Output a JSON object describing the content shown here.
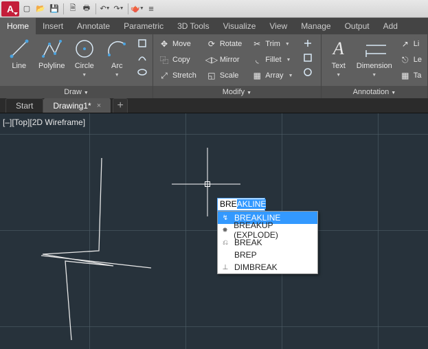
{
  "titlebar": {
    "qat_icons": [
      "new-icon",
      "open-icon",
      "save-icon",
      "saveas-icon",
      "print-icon",
      "undo-icon",
      "redo-icon",
      "plot-icon"
    ]
  },
  "ribbon_tabs": [
    "Home",
    "Insert",
    "Annotate",
    "Parametric",
    "3D Tools",
    "Visualize",
    "View",
    "Manage",
    "Output",
    "Add"
  ],
  "active_ribbon_tab": "Home",
  "panels": {
    "draw": {
      "title": "Draw",
      "items": {
        "line": "Line",
        "polyline": "Polyline",
        "circle": "Circle",
        "arc": "Arc"
      }
    },
    "modify": {
      "title": "Modify",
      "row1": {
        "move": "Move",
        "rotate": "Rotate",
        "trim": "Trim"
      },
      "row2": {
        "copy": "Copy",
        "mirror": "Mirror",
        "fillet": "Fillet"
      },
      "row3": {
        "stretch": "Stretch",
        "scale": "Scale",
        "array": "Array"
      }
    },
    "annotation": {
      "title": "Annotation",
      "text": "Text",
      "dimension": "Dimension",
      "side": {
        "leader": "Le",
        "table": "Ta",
        "line": "Li"
      }
    }
  },
  "file_tabs": {
    "start": "Start",
    "active": "Drawing1*"
  },
  "viewport_label": "[–][Top][2D Wireframe]",
  "command": {
    "typed": "BRE",
    "completion": "AKLINE",
    "suggestions": [
      {
        "label": "BREAKLINE",
        "icon": "breakline-icon"
      },
      {
        "label": "BREAKUP (EXPLODE)",
        "icon": "explode-icon"
      },
      {
        "label": "BREAK",
        "icon": "break-icon"
      },
      {
        "label": "BREP",
        "icon": ""
      },
      {
        "label": "DIMBREAK",
        "icon": "dimbreak-icon"
      }
    ],
    "selected_index": 0
  }
}
